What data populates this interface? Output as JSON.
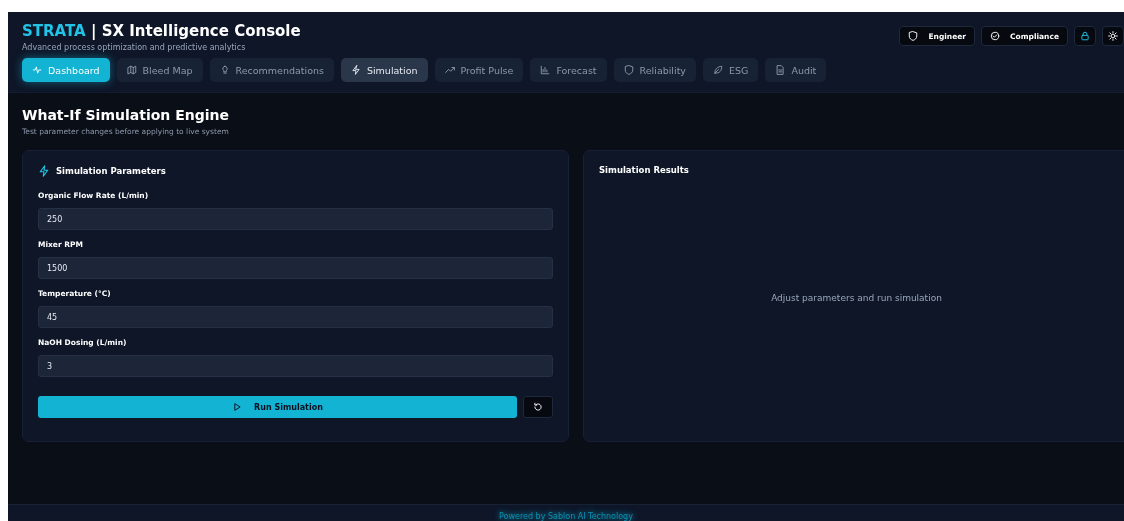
{
  "header": {
    "brand": "STRATA",
    "title": "| SX Intelligence Console",
    "subtitle": "Advanced process optimization and predictive analytics"
  },
  "header_buttons": [
    {
      "kind": "shield",
      "label": "Engineer"
    },
    {
      "kind": "check",
      "label": "Compliance"
    },
    {
      "kind": "lock"
    },
    {
      "kind": "sun"
    }
  ],
  "tabs": [
    {
      "kind": "pulse",
      "label": "Dashboard",
      "selected": true,
      "hovered": false
    },
    {
      "kind": "map",
      "label": "Bleed Map",
      "selected": false,
      "hovered": false
    },
    {
      "kind": "bulb",
      "label": "Recommendations",
      "selected": false,
      "hovered": false
    },
    {
      "kind": "bolt",
      "label": "Simulation",
      "selected": false,
      "hovered": true
    },
    {
      "kind": "trend",
      "label": "Profit Pulse",
      "selected": false,
      "hovered": false
    },
    {
      "kind": "bars",
      "label": "Forecast",
      "selected": false,
      "hovered": false
    },
    {
      "kind": "shield",
      "label": "Reliability",
      "selected": false,
      "hovered": false
    },
    {
      "kind": "leaf",
      "label": "ESG",
      "selected": false,
      "hovered": false
    },
    {
      "kind": "doc",
      "label": "Audit",
      "selected": false,
      "hovered": false
    }
  ],
  "page": {
    "title": "What-If Simulation Engine",
    "subtitle": "Test parameter changes before applying to live system"
  },
  "parameters": {
    "title": "Simulation Parameters",
    "fields": [
      {
        "label": "Organic Flow Rate (L/min)",
        "value": "250"
      },
      {
        "label": "Mixer RPM",
        "value": "1500"
      },
      {
        "label": "Temperature (°C)",
        "value": "45"
      },
      {
        "label": "NaOH Dosing (L/min)",
        "value": "3"
      }
    ],
    "run_button": "Run Simulation"
  },
  "results": {
    "title": "Simulation Results",
    "empty_message": "Adjust parameters and run simulation"
  },
  "footer": "Powered by Sablon AI Technology"
}
